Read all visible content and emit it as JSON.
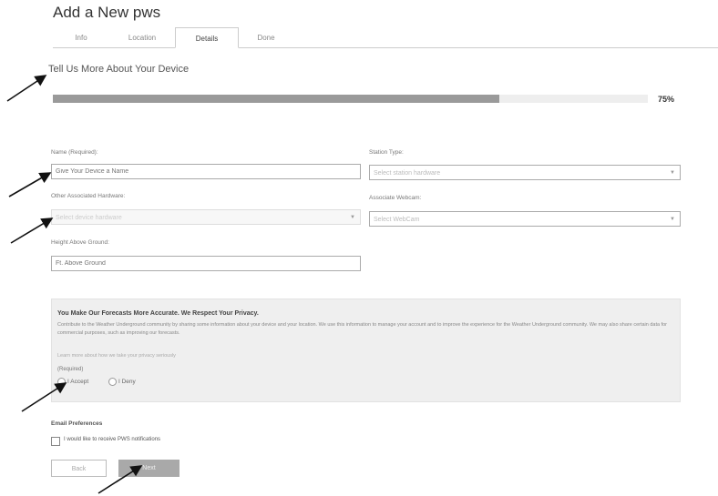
{
  "page": {
    "title": "Add a New pws",
    "tabs": [
      {
        "label": "Info"
      },
      {
        "label": "Location"
      },
      {
        "label": "Details"
      },
      {
        "label": "Done"
      }
    ],
    "active_tab": 2,
    "section_title": "Tell Us More About Your Device"
  },
  "progress": {
    "percent": 75,
    "label": "75%"
  },
  "form": {
    "name_label": "Name (Required):",
    "name_placeholder": "Give Your Device a Name",
    "station_type_label": "Station Type:",
    "station_type_placeholder": "Select station hardware",
    "other_hardware_label": "Other Associated Hardware:",
    "other_hardware_placeholder": "Select device hardware",
    "webcam_label": "Associate Webcam:",
    "webcam_placeholder": "Select WebCam",
    "height_label": "Height Above Ground:",
    "height_placeholder": "Ft. Above Ground"
  },
  "privacy": {
    "title": "You Make Our Forecasts More Accurate. We Respect Your Privacy.",
    "text": "Contribute to the Weather Underground community by sharing some information about your device and your location. We use this information to manage your account and to improve the experience for the Weather Underground community. We may also share certain data for commercial purposes, such as improving our forecasts.",
    "link": "Learn more about how we take your privacy seriously",
    "required": "(Required)",
    "accept": "I Accept",
    "deny": "I Deny"
  },
  "email": {
    "heading": "Email Preferences",
    "checkbox_label": "I would like to receive PWS notifications"
  },
  "buttons": {
    "back": "Back",
    "next": "Next"
  },
  "colors": {
    "progress_fill": "#9a9a9a",
    "next_button": "#a9a9a9",
    "privacy_bg": "#efefef"
  }
}
